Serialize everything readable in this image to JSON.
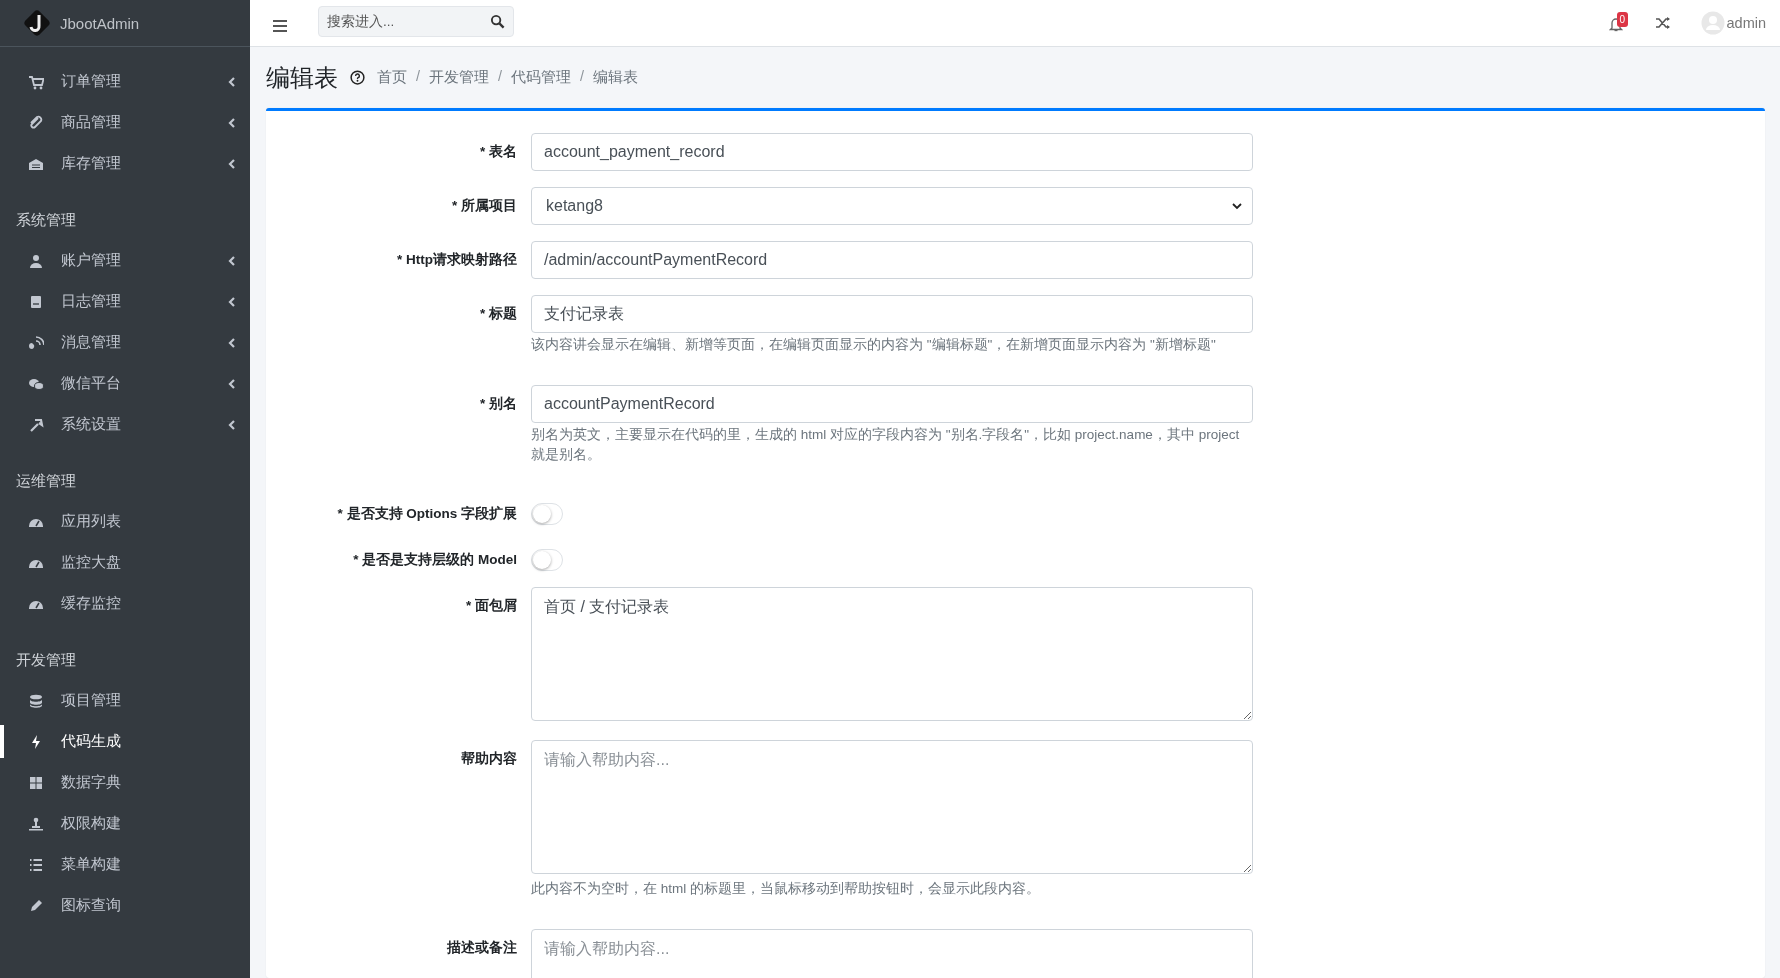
{
  "brand": {
    "name": "JbootAdmin"
  },
  "sidebar": {
    "groups": [
      {
        "items": [
          {
            "label": "订单管理",
            "expanded": false,
            "selected": false
          },
          {
            "label": "商品管理",
            "expanded": false,
            "selected": false
          },
          {
            "label": "库存管理",
            "expanded": false,
            "selected": false
          }
        ]
      },
      {
        "title": "系统管理",
        "items": [
          {
            "label": "账户管理",
            "expanded": false,
            "selected": false
          },
          {
            "label": "日志管理",
            "expanded": false,
            "selected": false
          },
          {
            "label": "消息管理",
            "expanded": false,
            "selected": false
          },
          {
            "label": "微信平台",
            "expanded": false,
            "selected": false
          },
          {
            "label": "系统设置",
            "expanded": false,
            "selected": false
          }
        ]
      },
      {
        "title": "运维管理",
        "items": [
          {
            "label": "应用列表",
            "selected": false
          },
          {
            "label": "监控大盘",
            "selected": false
          },
          {
            "label": "缓存监控",
            "selected": false
          }
        ]
      },
      {
        "title": "开发管理",
        "items": [
          {
            "label": "项目管理",
            "selected": false
          },
          {
            "label": "代码生成",
            "selected": true
          },
          {
            "label": "数据字典",
            "selected": false
          },
          {
            "label": "权限构建",
            "selected": false
          },
          {
            "label": "菜单构建",
            "selected": false
          },
          {
            "label": "图标查询",
            "selected": false
          }
        ]
      }
    ]
  },
  "topbar": {
    "search": {
      "placeholder": "搜索进入..."
    },
    "notifications": "0",
    "user": "admin"
  },
  "page": {
    "title": "编辑表",
    "breadcrumb": [
      {
        "kind": "link",
        "text": "首页"
      },
      {
        "kind": "separator",
        "text": "/"
      },
      {
        "kind": "link",
        "text": "开发管理"
      },
      {
        "kind": "separator",
        "text": "/"
      },
      {
        "kind": "link",
        "text": "代码管理"
      },
      {
        "kind": "separator",
        "text": "/"
      },
      {
        "kind": "link",
        "text": "编辑表"
      }
    ]
  },
  "form": {
    "fields": [
      {
        "kind": "text",
        "label": "* 表名",
        "value": "account_payment_record"
      },
      {
        "kind": "select",
        "label": "* 所属项目",
        "value": "ketang8"
      },
      {
        "kind": "text",
        "label": "* Http请求映射路径",
        "value": "/admin/accountPaymentRecord"
      },
      {
        "kind": "text",
        "label": "* 标题",
        "value": "支付记录表",
        "help": "该内容讲会显示在编辑、新增等页面，在编辑页面显示的内容为 \"编辑标题\"，在新增页面显示内容为 \"新增标题\""
      },
      {
        "kind": "text",
        "label": "* 别名",
        "value": "accountPaymentRecord",
        "help": "别名为英文，主要显示在代码的里，生成的 html 对应的字段内容为 \"别名.字段名\"，比如 project.name，其中 project 就是别名。"
      },
      {
        "kind": "toggle",
        "label": "* 是否支持 Options 字段扩展",
        "on": false
      },
      {
        "kind": "toggle",
        "label": "* 是否是支持层级的 Model",
        "on": false
      },
      {
        "kind": "textarea",
        "label": "* 面包屑",
        "value": "首页 / 支付记录表"
      },
      {
        "kind": "textarea",
        "label": "帮助内容",
        "placeholder": "请输入帮助内容...",
        "help": "此内容不为空时，在 html 的标题里，当鼠标移动到帮助按钮时，会显示此段内容。"
      },
      {
        "kind": "textarea",
        "label": "描述或备注",
        "placeholder": "请输入帮助内容..."
      }
    ]
  }
}
